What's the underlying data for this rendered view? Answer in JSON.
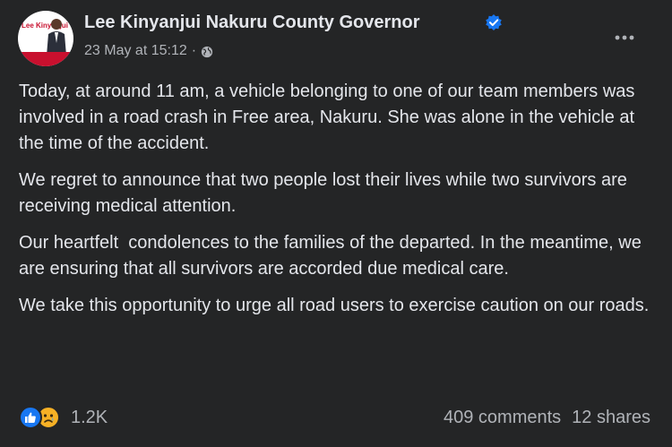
{
  "post": {
    "author": "Lee Kinyanjui Nakuru County Governor",
    "timestamp": "23 May at 15:12",
    "separator": "·",
    "audience_icon": "globe-icon",
    "verified_icon": "verified-badge-icon",
    "paragraphs": [
      "Today, at around 11 am, a vehicle belonging to one of our team members was involved in a road crash in Free area, Nakuru. She was alone in the vehicle at the time of the accident.",
      "We regret to announce that two people lost their lives while two survivors are receiving medical attention.",
      "Our heartfelt  condolences to the families of the departed. In the meantime, we are ensuring that all survivors are accorded due medical care.",
      "We take this opportunity to urge all road users to exercise caution on our roads."
    ]
  },
  "avatar": {
    "logo_text": "Lee Kinyanjui"
  },
  "footer": {
    "reaction_icons": [
      "like-icon",
      "sad-icon"
    ],
    "reaction_count": "1.2K",
    "comments": "409 comments",
    "shares": "12 shares"
  },
  "colors": {
    "background": "#242526",
    "text_primary": "#e4e6eb",
    "text_secondary": "#b0b3b8",
    "verified_blue": "#1877f2",
    "like_blue": "#1877f2",
    "sad_yellow": "#f7b125"
  }
}
